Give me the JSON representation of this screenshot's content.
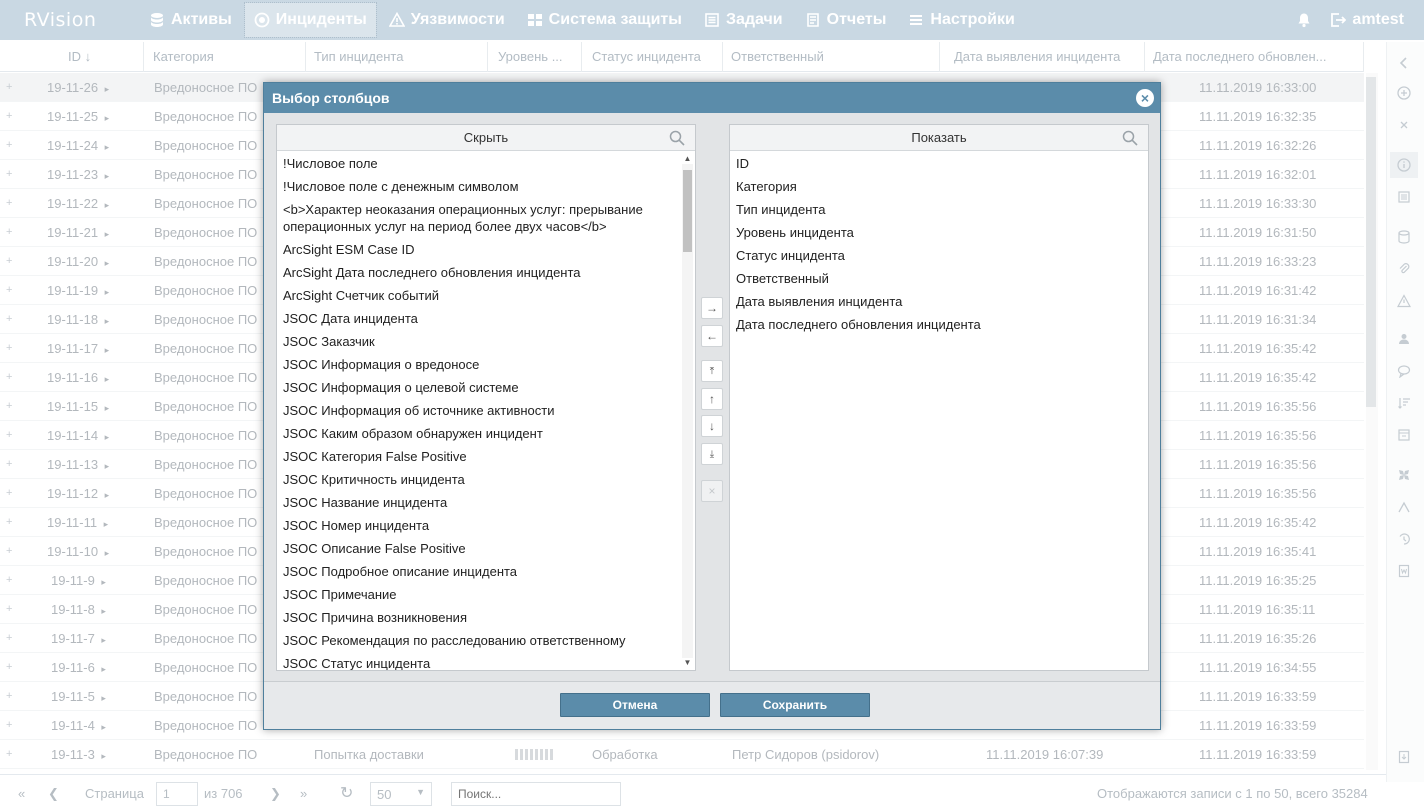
{
  "app": {
    "logo": "RVision"
  },
  "nav": [
    {
      "label": "Активы",
      "icon": "database-icon"
    },
    {
      "label": "Инциденты",
      "icon": "target-icon",
      "active": true
    },
    {
      "label": "Уязвимости",
      "icon": "warning-icon"
    },
    {
      "label": "Система защиты",
      "icon": "shield-grid-icon"
    },
    {
      "label": "Задачи",
      "icon": "tasks-icon"
    },
    {
      "label": "Отчеты",
      "icon": "report-icon"
    },
    {
      "label": "Настройки",
      "icon": "menu-icon"
    }
  ],
  "user": {
    "name": "amtest"
  },
  "grid": {
    "columns": [
      "ID",
      "Категория",
      "Тип инцидента",
      "Уровень ...",
      "Статус инцидента",
      "Ответственный",
      "Дата выявления инцидента",
      "Дата последнего обновлен..."
    ],
    "rows": [
      {
        "id": "19-11-26",
        "category": "Вредоносное ПО",
        "updated": "11.11.2019 16:33:00"
      },
      {
        "id": "19-11-25",
        "category": "Вредоносное ПО",
        "updated": "11.11.2019 16:32:35"
      },
      {
        "id": "19-11-24",
        "category": "Вредоносное ПО",
        "updated": "11.11.2019 16:32:26"
      },
      {
        "id": "19-11-23",
        "category": "Вредоносное ПО",
        "updated": "11.11.2019 16:32:01"
      },
      {
        "id": "19-11-22",
        "category": "Вредоносное ПО",
        "updated": "11.11.2019 16:33:30"
      },
      {
        "id": "19-11-21",
        "category": "Вредоносное ПО",
        "updated": "11.11.2019 16:31:50"
      },
      {
        "id": "19-11-20",
        "category": "Вредоносное ПО",
        "updated": "11.11.2019 16:33:23"
      },
      {
        "id": "19-11-19",
        "category": "Вредоносное ПО",
        "updated": "11.11.2019 16:31:42"
      },
      {
        "id": "19-11-18",
        "category": "Вредоносное ПО",
        "updated": "11.11.2019 16:31:34"
      },
      {
        "id": "19-11-17",
        "category": "Вредоносное ПО",
        "updated": "11.11.2019 16:35:42"
      },
      {
        "id": "19-11-16",
        "category": "Вредоносное ПО",
        "updated": "11.11.2019 16:35:42"
      },
      {
        "id": "19-11-15",
        "category": "Вредоносное ПО",
        "updated": "11.11.2019 16:35:56"
      },
      {
        "id": "19-11-14",
        "category": "Вредоносное ПО",
        "updated": "11.11.2019 16:35:56"
      },
      {
        "id": "19-11-13",
        "category": "Вредоносное ПО",
        "updated": "11.11.2019 16:35:56"
      },
      {
        "id": "19-11-12",
        "category": "Вредоносное ПО",
        "updated": "11.11.2019 16:35:56"
      },
      {
        "id": "19-11-11",
        "category": "Вредоносное ПО",
        "updated": "11.11.2019 16:35:42"
      },
      {
        "id": "19-11-10",
        "category": "Вредоносное ПО",
        "updated": "11.11.2019 16:35:41"
      },
      {
        "id": "19-11-9",
        "category": "Вредоносное ПО",
        "updated": "11.11.2019 16:35:25"
      },
      {
        "id": "19-11-8",
        "category": "Вредоносное ПО",
        "updated": "11.11.2019 16:35:11"
      },
      {
        "id": "19-11-7",
        "category": "Вредоносное ПО",
        "updated": "11.11.2019 16:35:26"
      },
      {
        "id": "19-11-6",
        "category": "Вредоносное ПО",
        "updated": "11.11.2019 16:34:55"
      },
      {
        "id": "19-11-5",
        "category": "Вредоносное ПО",
        "updated": "11.11.2019 16:33:59"
      },
      {
        "id": "19-11-4",
        "category": "Вредоносное ПО",
        "updated": "11.11.2019 16:33:59"
      },
      {
        "id": "19-11-3",
        "category": "Вредоносное ПО",
        "type": "Попытка доставки",
        "status": "Обработка",
        "owner": "Петр Сидоров (psidorov)",
        "detected": "11.11.2019 16:07:39",
        "updated": "11.11.2019 16:33:59"
      }
    ]
  },
  "pager": {
    "page_label": "Страница",
    "page_value": "1",
    "of_label": "из 706",
    "per_page": "50",
    "search_placeholder": "Поиск...",
    "summary": "Отображаются записи с 1 по 50, всего 35284"
  },
  "modal": {
    "title": "Выбор столбцов",
    "hide_title": "Скрыть",
    "show_title": "Показать",
    "hidden_items": [
      "!Числовое поле",
      "!Числовое поле с денежным символом",
      "<b>Характер неоказания операционных услуг: прерывание операционных услуг на период более двух часов</b>",
      "ArcSight ESM Case ID",
      "ArcSight Дата последнего обновления инцидента",
      "ArcSight Счетчик событий",
      "JSOC Дата инцидента",
      "JSOC Заказчик",
      "JSOC Информация о вредоносе",
      "JSOC Информация о целевой системе",
      "JSOC Информация об источнике активности",
      "JSOC Каким образом обнаружен инцидент",
      "JSOC Категория False Positive",
      "JSOC Критичность инцидента",
      "JSOC Название инцидента",
      "JSOC Номер инцидента",
      "JSOC Описание False Positive",
      "JSOC Подробное описание инцидента",
      "JSOC Примечание",
      "JSOC Причина возникновения",
      "JSOC Рекомендация по расследованию ответственному",
      "JSOC Статус инцидента"
    ],
    "shown_items": [
      "ID",
      "Категория",
      "Тип инцидента",
      "Уровень инцидента",
      "Статус инцидента",
      "Ответственный",
      "Дата выявления инцидента",
      "Дата последнего обновления инцидента"
    ],
    "cancel_label": "Отмена",
    "save_label": "Сохранить"
  },
  "colors": {
    "nav_bg": "#c9d8e3",
    "modal_header": "#5b8caa",
    "button": "#5b8caa"
  }
}
